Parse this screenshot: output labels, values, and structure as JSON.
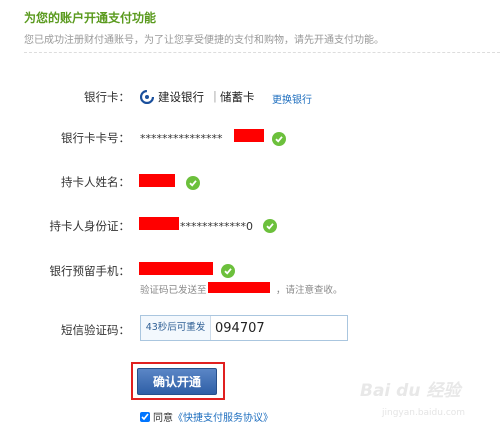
{
  "page": {
    "title": "为您的账户开通支付功能",
    "subtitle": "您已成功注册财付通账号，为了让您享受便捷的支付和购物，请先开通支付功能。"
  },
  "form": {
    "bank_card": {
      "label": "银行卡：",
      "bank_name": "建设银行",
      "separator": "|",
      "card_type": "储蓄卡",
      "change_link": "更换银行"
    },
    "card_number": {
      "label": "银行卡卡号：",
      "value_prefix": "***************"
    },
    "holder_name": {
      "label": "持卡人姓名："
    },
    "id_number": {
      "label": "持卡人身份证：",
      "value_suffix": "************0"
    },
    "phone": {
      "label": "银行预留手机：",
      "hint_prefix": "验证码已发送至",
      "hint_suffix": "，请注意查收。"
    },
    "sms": {
      "label": "短信验证码：",
      "resend_label": "43秒后可重发",
      "code_value": "094707"
    },
    "confirm_button": "确认开通",
    "agreement": {
      "prefix": "同意",
      "link": "《快捷支付服务协议》",
      "checked": true
    }
  },
  "watermark": {
    "brand": "Bai du 经验",
    "url": "jingyan.baidu.com"
  },
  "colors": {
    "accent_green": "#5a9a1e",
    "check_green": "#6cc03c",
    "link_blue": "#1f6fbf",
    "redaction_red": "#ff0000",
    "button_blue": "#2e5fa6"
  }
}
